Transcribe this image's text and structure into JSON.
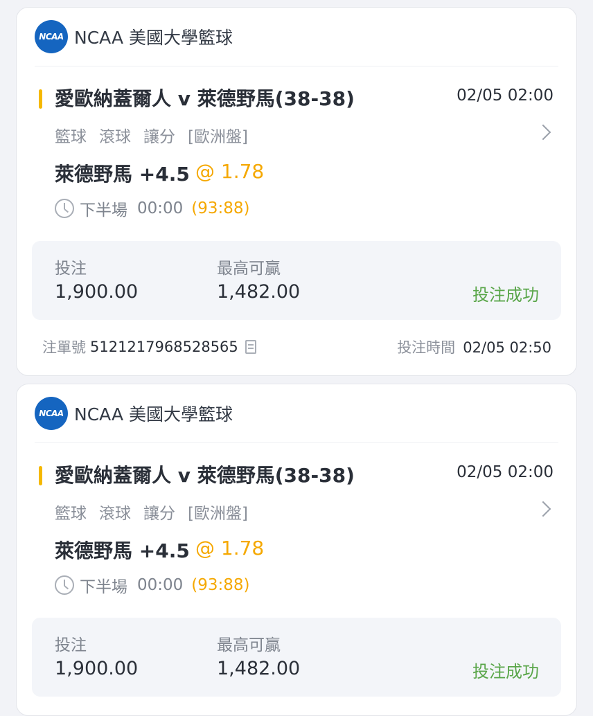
{
  "bets": [
    {
      "league": {
        "logo_text": "NCAA",
        "name": "NCAA 美國大學籃球"
      },
      "match": {
        "title": "愛歐納蓋爾人 v 萊德野馬(38-38)",
        "time": "02/05 02:00"
      },
      "bet_type": {
        "sport": "籃球",
        "mode": "滾球",
        "market": "讓分",
        "odds_format": "[歐洲盤]"
      },
      "selection": "萊德野馬 +4.5",
      "odds": "@ 1.78",
      "live": {
        "period": "下半場",
        "clock": "00:00",
        "score": "(93:88)"
      },
      "stake": {
        "label": "投注",
        "value": "1,900.00"
      },
      "max_win": {
        "label": "最高可贏",
        "value": "1,482.00"
      },
      "status": "投注成功",
      "ticket": {
        "label": "注單號",
        "number": "5121217968528565"
      },
      "placed": {
        "label": "投注時間",
        "time": "02/05 02:50"
      }
    },
    {
      "league": {
        "logo_text": "NCAA",
        "name": "NCAA 美國大學籃球"
      },
      "match": {
        "title": "愛歐納蓋爾人 v 萊德野馬(38-38)",
        "time": "02/05 02:00"
      },
      "bet_type": {
        "sport": "籃球",
        "mode": "滾球",
        "market": "讓分",
        "odds_format": "[歐洲盤]"
      },
      "selection": "萊德野馬 +4.5",
      "odds": "@ 1.78",
      "live": {
        "period": "下半場",
        "clock": "00:00",
        "score": "(93:88)"
      },
      "stake": {
        "label": "投注",
        "value": "1,900.00"
      },
      "max_win": {
        "label": "最高可贏",
        "value": "1,482.00"
      },
      "status": "投注成功"
    }
  ],
  "colors": {
    "accent": "#f5b800",
    "odds": "#f5a800",
    "success": "#5aa64a",
    "logo": "#1565c0"
  }
}
